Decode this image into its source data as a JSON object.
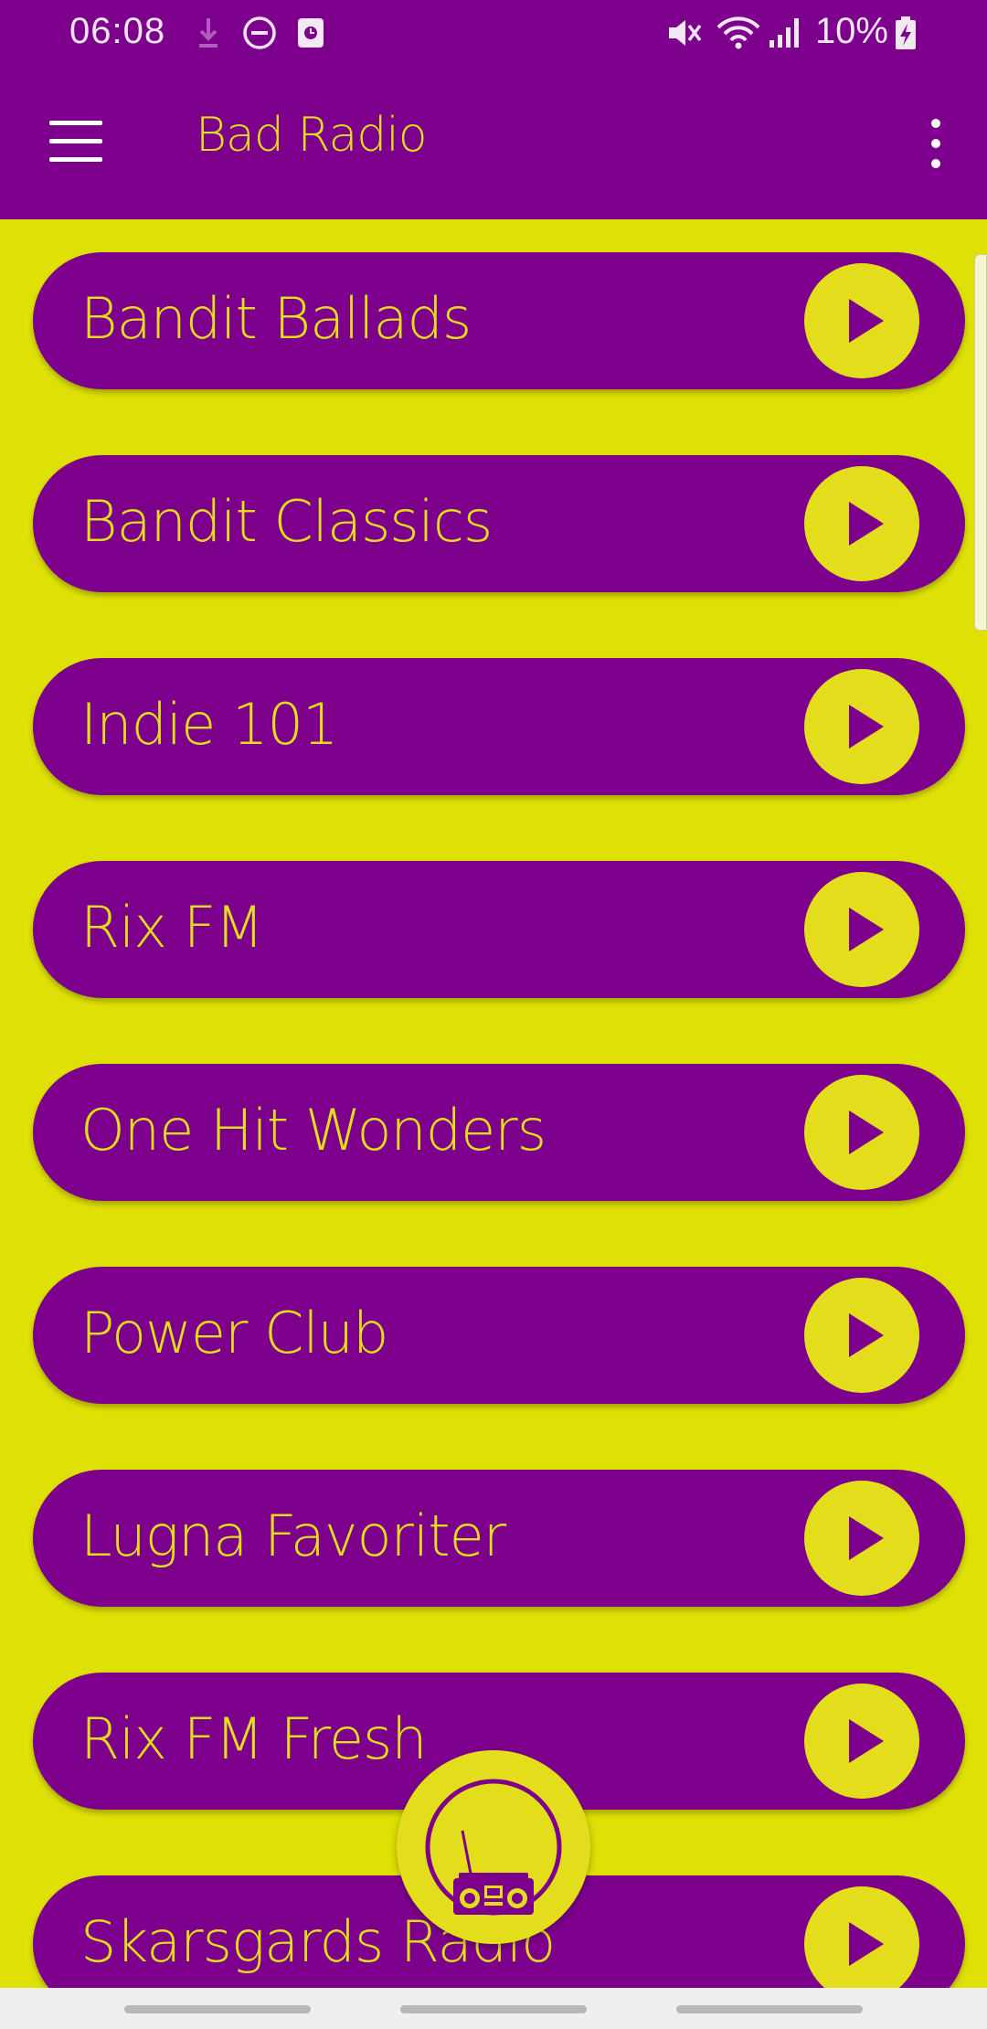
{
  "status_bar": {
    "time": "06:08",
    "battery": "10%",
    "icons": [
      "download-icon",
      "do-not-disturb-icon",
      "screenshot-icon",
      "mute-icon",
      "wifi-icon",
      "signal-icon",
      "battery-charging-icon"
    ]
  },
  "app_bar": {
    "title": "Bad Radio",
    "menu_icon": "hamburger-menu-icon",
    "overflow_icon": "more-vert-icon"
  },
  "stations": [
    {
      "name": "Bandit Ballads"
    },
    {
      "name": "Bandit Classics"
    },
    {
      "name": "Indie 101"
    },
    {
      "name": "Rix FM"
    },
    {
      "name": "One Hit Wonders"
    },
    {
      "name": "Power Club"
    },
    {
      "name": "Lugna Favoriter"
    },
    {
      "name": "Rix FM Fresh"
    },
    {
      "name": "Skarsgards Radio"
    }
  ],
  "fab": {
    "icon": "boombox-radio-icon"
  },
  "colors": {
    "primary": "#7d008c",
    "accent": "#e3dd1b",
    "background": "#dfe005"
  }
}
